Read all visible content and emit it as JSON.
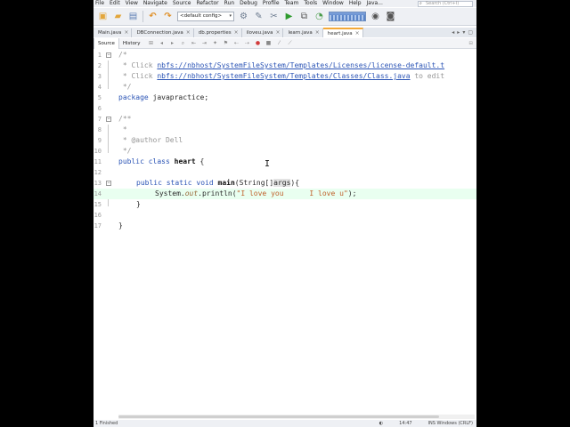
{
  "menu": [
    "File",
    "Edit",
    "View",
    "Navigate",
    "Source",
    "Refactor",
    "Run",
    "Debug",
    "Profile",
    "Team",
    "Tools",
    "Window",
    "Help"
  ],
  "search_placeholder": "Search (Ctrl+I)",
  "toolbar": {
    "config_value": "<default config>",
    "icons": [
      "new-project-icon",
      "open-folder-icon",
      "save-all-icon",
      "undo-icon",
      "redo-icon",
      "build-icon",
      "clean-build-icon",
      "run-icon",
      "debug-icon",
      "profile-icon",
      "cpu-meter",
      "gc-icon",
      "pause-icon"
    ]
  },
  "tabs": [
    {
      "label": "Main.java",
      "active": false
    },
    {
      "label": "DBConnection.java",
      "active": false
    },
    {
      "label": "db.properties",
      "active": false
    },
    {
      "label": "iloveu.java",
      "active": false
    },
    {
      "label": "learn.java",
      "active": false
    },
    {
      "label": "heart.java",
      "active": true
    }
  ],
  "editor_modes": {
    "source": "Source",
    "history": "History"
  },
  "code": {
    "l1": "/*",
    "l2_prefix": " * Click ",
    "l2_link": "nbfs://nbhost/SystemFileSystem/Templates/Licenses/license-default.t",
    "l3_prefix": " * Click ",
    "l3_link": "nbfs://nbhost/SystemFileSystem/Templates/Classes/Class.java",
    "l3_suffix": " to edit",
    "l4": " */",
    "l5_kw": "package",
    "l5_rest": " javapractice;",
    "l7": "/**",
    "l8": " *",
    "l9": " * @author Dell",
    "l10": " */",
    "l11_kw": "public class",
    "l11_name": "heart",
    "l11_rest": " {",
    "l13_kw": "public static void",
    "l13_name": "main",
    "l13_params": "(String[]",
    "l13_arg": "args",
    "l13_end": "){",
    "l14_sys": "System.",
    "l14_out": "out",
    "l14_call": ".println(",
    "l14_str": "\"I love you      I love u\"",
    "l14_end": ");",
    "l15": "}",
    "l17": "}"
  },
  "line_numbers": [
    "1",
    "2",
    "3",
    "4",
    "5",
    "6",
    "7",
    "8",
    "9",
    "10",
    "11",
    "12",
    "13",
    "14",
    "15",
    "16",
    "17"
  ],
  "status": {
    "left": "1 Finished",
    "position": "14:47",
    "mode": "INS  Windows (CRLF)"
  },
  "menu_extra": "Java..."
}
